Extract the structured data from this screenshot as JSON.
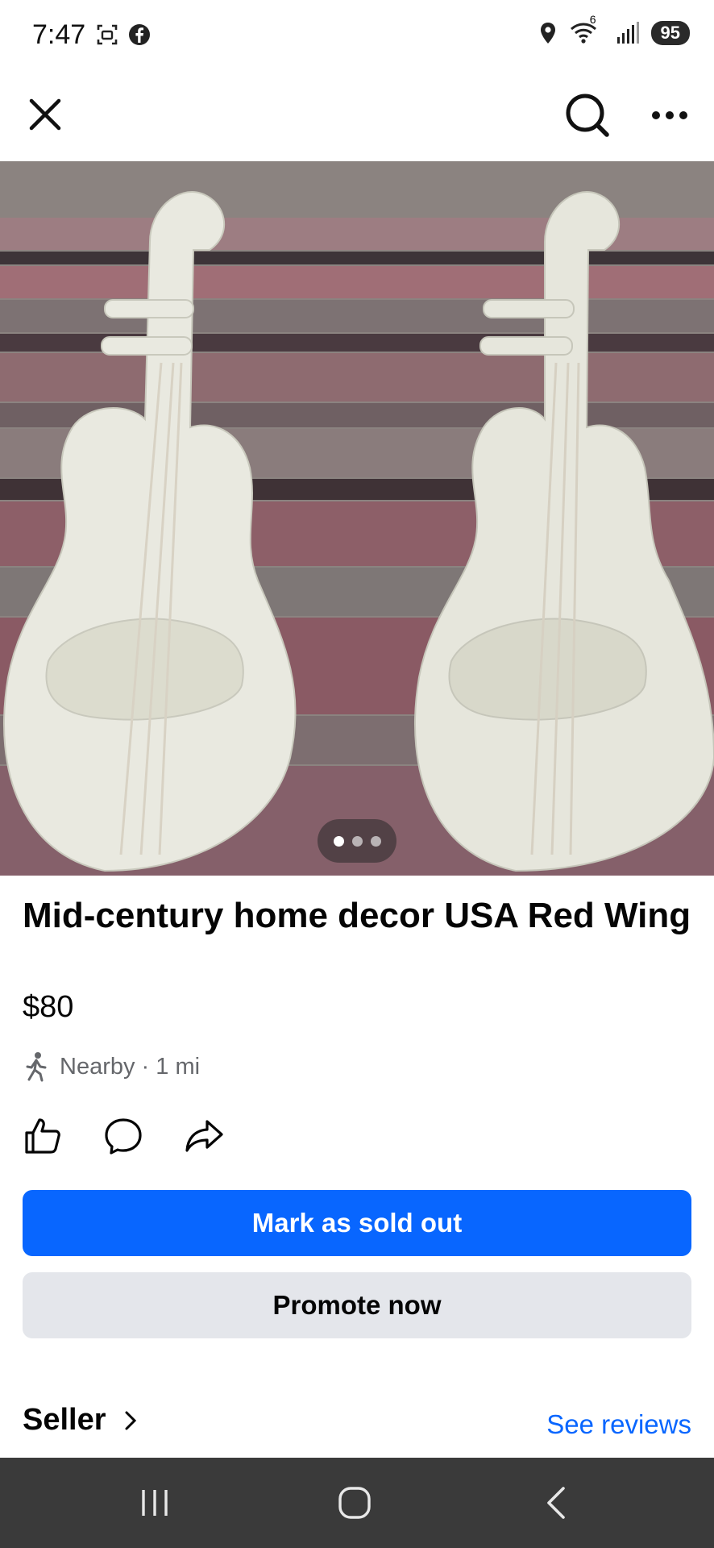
{
  "status_bar": {
    "time": "7:47",
    "left_icons": [
      "screenshot-icon",
      "facebook-icon"
    ],
    "right_icons": [
      "location-icon",
      "wifi-icon",
      "signal-icon"
    ],
    "network_label": "6",
    "battery": "95"
  },
  "top_bar": {
    "close_icon": "close-icon",
    "search_icon": "search-icon",
    "more_icon": "more-icon"
  },
  "gallery": {
    "photo_count": 3,
    "active_index": 0
  },
  "listing": {
    "title": "Mid-century home decor USA Red Wing",
    "price": "$80",
    "location": "Nearby · 1 mi"
  },
  "reactions": [
    "like-icon",
    "comment-icon",
    "share-icon"
  ],
  "actions": {
    "primary_label": "Mark as sold out",
    "secondary_label": "Promote now"
  },
  "seller": {
    "label": "Seller",
    "reviews_link": "See reviews"
  },
  "colors": {
    "accent": "#0866ff",
    "secondary_button": "#e4e6eb",
    "muted_text": "#65676b",
    "nav_bar": "#3a3a3a"
  }
}
